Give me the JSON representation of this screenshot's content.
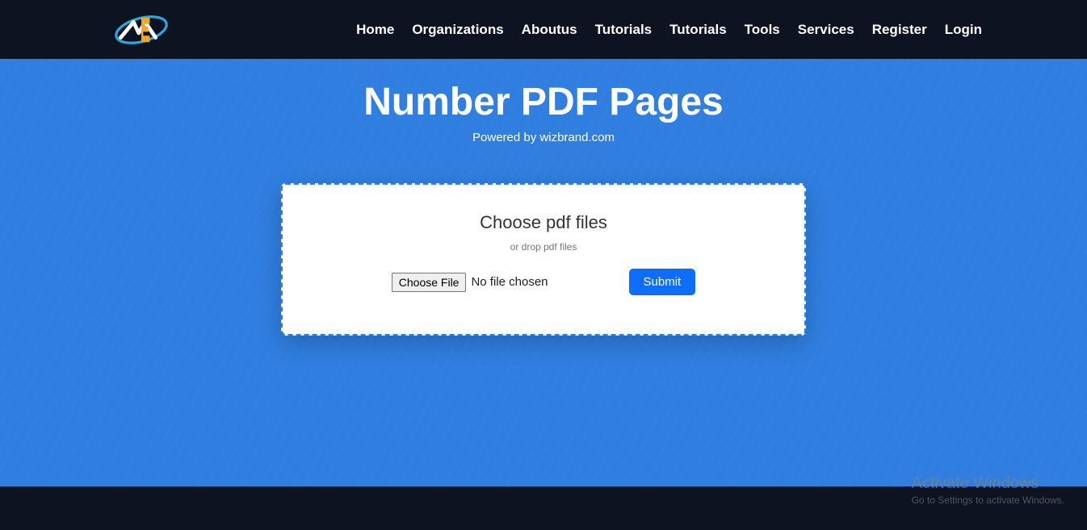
{
  "nav": {
    "items": [
      {
        "label": "Home"
      },
      {
        "label": "Organizations"
      },
      {
        "label": "Aboutus"
      },
      {
        "label": "Tutorials"
      },
      {
        "label": "Tutorials"
      },
      {
        "label": "Tools"
      },
      {
        "label": "Services"
      },
      {
        "label": "Register"
      },
      {
        "label": "Login"
      }
    ]
  },
  "hero": {
    "title": "Number PDF Pages",
    "subtitle": "Powered by wizbrand.com"
  },
  "upload": {
    "title": "Choose pdf files",
    "hint": "or drop pdf files",
    "choose_label": "Choose File",
    "file_status": "No file chosen",
    "submit_label": "Submit"
  },
  "watermark": {
    "title": "Activate Windows",
    "subtitle": "Go to Settings to activate Windows."
  }
}
